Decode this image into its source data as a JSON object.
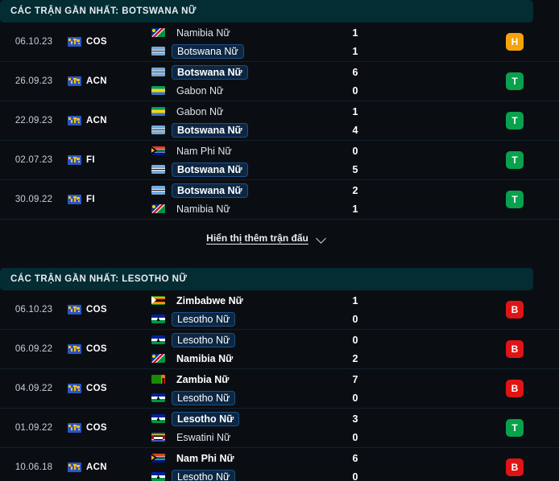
{
  "sections": [
    {
      "header": "CÁC TRẬN GẦN NHẤT: BOTSWANA NỮ",
      "rows": [
        {
          "date": "06.10.23",
          "competition": "COS",
          "competition_icon": "world-map-icon",
          "home": {
            "team": "Namibia Nữ",
            "flag": "na",
            "highlight": false,
            "bold": false,
            "score": "1"
          },
          "away": {
            "team": "Botswana Nữ",
            "flag": "bw",
            "highlight": true,
            "bold": false,
            "score": "1"
          },
          "badge": {
            "label": "H",
            "color": "#f5a30a"
          }
        },
        {
          "date": "26.09.23",
          "competition": "ACN",
          "competition_icon": "world-map-icon",
          "home": {
            "team": "Botswana Nữ",
            "flag": "bw",
            "highlight": true,
            "bold": true,
            "score": "6"
          },
          "away": {
            "team": "Gabon Nữ",
            "flag": "ga",
            "highlight": false,
            "bold": false,
            "score": "0"
          },
          "badge": {
            "label": "T",
            "color": "#08a14c"
          }
        },
        {
          "date": "22.09.23",
          "competition": "ACN",
          "competition_icon": "world-map-icon",
          "home": {
            "team": "Gabon Nữ",
            "flag": "ga",
            "highlight": false,
            "bold": false,
            "score": "1"
          },
          "away": {
            "team": "Botswana Nữ",
            "flag": "bw",
            "highlight": true,
            "bold": true,
            "score": "4"
          },
          "badge": {
            "label": "T",
            "color": "#08a14c"
          }
        },
        {
          "date": "02.07.23",
          "competition": "FI",
          "competition_icon": "world-map-icon",
          "home": {
            "team": "Nam Phi Nữ",
            "flag": "za",
            "highlight": false,
            "bold": false,
            "score": "0"
          },
          "away": {
            "team": "Botswana Nữ",
            "flag": "bw",
            "highlight": true,
            "bold": true,
            "score": "5"
          },
          "badge": {
            "label": "T",
            "color": "#08a14c"
          }
        },
        {
          "date": "30.09.22",
          "competition": "FI",
          "competition_icon": "world-map-icon",
          "home": {
            "team": "Botswana Nữ",
            "flag": "bw",
            "highlight": true,
            "bold": true,
            "score": "2"
          },
          "away": {
            "team": "Namibia Nữ",
            "flag": "na",
            "highlight": false,
            "bold": false,
            "score": "1"
          },
          "badge": {
            "label": "T",
            "color": "#08a14c"
          }
        }
      ],
      "show_more": "Hiển thị thêm trận đấu"
    },
    {
      "header": "CÁC TRẬN GẦN NHẤT: LESOTHO NỮ",
      "rows": [
        {
          "date": "06.10.23",
          "competition": "COS",
          "competition_icon": "world-map-icon",
          "home": {
            "team": "Zimbabwe Nữ",
            "flag": "zw",
            "highlight": false,
            "bold": true,
            "score": "1"
          },
          "away": {
            "team": "Lesotho Nữ",
            "flag": "ls",
            "highlight": true,
            "bold": false,
            "score": "0"
          },
          "badge": {
            "label": "B",
            "color": "#e01414"
          }
        },
        {
          "date": "06.09.22",
          "competition": "COS",
          "competition_icon": "world-map-icon",
          "home": {
            "team": "Lesotho Nữ",
            "flag": "ls",
            "highlight": true,
            "bold": false,
            "score": "0"
          },
          "away": {
            "team": "Namibia Nữ",
            "flag": "na",
            "highlight": false,
            "bold": true,
            "score": "2"
          },
          "badge": {
            "label": "B",
            "color": "#e01414"
          }
        },
        {
          "date": "04.09.22",
          "competition": "COS",
          "competition_icon": "world-map-icon",
          "home": {
            "team": "Zambia Nữ",
            "flag": "zm",
            "highlight": false,
            "bold": true,
            "score": "7"
          },
          "away": {
            "team": "Lesotho Nữ",
            "flag": "ls",
            "highlight": true,
            "bold": false,
            "score": "0"
          },
          "badge": {
            "label": "B",
            "color": "#e01414"
          }
        },
        {
          "date": "01.09.22",
          "competition": "COS",
          "competition_icon": "world-map-icon",
          "home": {
            "team": "Lesotho Nữ",
            "flag": "ls",
            "highlight": true,
            "bold": true,
            "score": "3"
          },
          "away": {
            "team": "Eswatini Nữ",
            "flag": "sz",
            "highlight": false,
            "bold": false,
            "score": "0"
          },
          "badge": {
            "label": "T",
            "color": "#08a14c"
          }
        },
        {
          "date": "10.06.18",
          "competition": "ACN",
          "competition_icon": "world-map-icon",
          "home": {
            "team": "Nam Phi Nữ",
            "flag": "za",
            "highlight": false,
            "bold": true,
            "score": "6"
          },
          "away": {
            "team": "Lesotho Nữ",
            "flag": "ls",
            "highlight": true,
            "bold": false,
            "score": "0"
          },
          "badge": {
            "label": "B",
            "color": "#e01414"
          }
        }
      ],
      "show_more": null
    }
  ]
}
